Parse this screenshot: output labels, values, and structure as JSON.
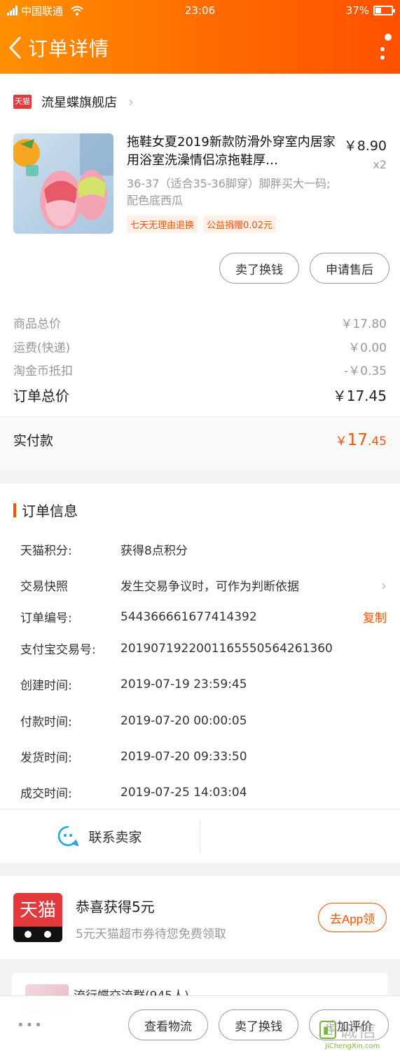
{
  "status_bar": {
    "carrier": "中国联通",
    "time": "23:06",
    "battery": "37%",
    "battery_level": 0.37
  },
  "header": {
    "title": "订单详情"
  },
  "shop": {
    "badge": "天猫",
    "name": "流星蝶旗舰店"
  },
  "item": {
    "title": "拖鞋女夏2019新款防滑外穿室内居家用浴室洗澡情侣凉拖鞋厚…",
    "sku": "36-37（适合35-36脚穿）脚胖买大一码;配色底西瓜",
    "price": "￥8.90",
    "qty": "x2",
    "tags": [
      "七天无理由退换",
      "公益捐赠0.02元"
    ],
    "actions": [
      "卖了换钱",
      "申请售后"
    ]
  },
  "costs": [
    {
      "label": "商品总价",
      "value": "￥17.80"
    },
    {
      "label": "运费(快递)",
      "value": "￥0.00"
    },
    {
      "label": "淘金币抵扣",
      "value": "-￥0.35"
    }
  ],
  "order_total": {
    "label": "订单总价",
    "value": "￥17.45"
  },
  "paid": {
    "label": "实付款",
    "currency": "￥",
    "int": "17",
    "dec": ".45"
  },
  "order_info": {
    "title": "订单信息",
    "rows": [
      {
        "label": "天猫积分:",
        "value": "获得8点积分"
      },
      {
        "label": "交易快照",
        "value": "发生交易争议时，可作为判断依据"
      },
      {
        "label": "订单编号:",
        "value": "544366661677414392",
        "action": "复制"
      },
      {
        "label": "支付宝交易号:",
        "value": "2019071922001165550564261360"
      },
      {
        "label": "创建时间:",
        "value": "2019-07-19 23:59:45"
      },
      {
        "label": "付款时间:",
        "value": "2019-07-20 00:00:05"
      },
      {
        "label": "发货时间:",
        "value": "2019-07-20 09:33:50"
      },
      {
        "label": "成交时间:",
        "value": "2019-07-25 14:03:04"
      }
    ]
  },
  "contact": {
    "label": "联系卖家"
  },
  "promo": {
    "logo_text": "天猫",
    "title": "恭喜获得5元",
    "subtitle": "5元天猫超市券待您免费领取",
    "button": "去App领"
  },
  "group": {
    "name": "流行蝶交流群(945人)"
  },
  "bottom_bar": {
    "more": "•••",
    "buttons": [
      "查看物流",
      "卖了换钱",
      "追加评价"
    ]
  },
  "watermark": {
    "text": "诚信",
    "url": "JiChengXin.com"
  }
}
